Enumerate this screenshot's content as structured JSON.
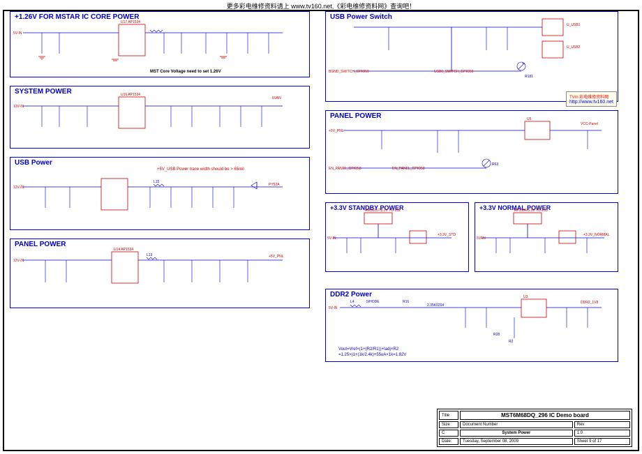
{
  "header": "更多彩电维修资料请上 www.tv160.net,《彩电维修资料网》查询吧！",
  "blocks": {
    "b1": {
      "title": "+1.26V FOR MSTAR IC CORE POWER",
      "note": "MST Core Voltage need to set 1.26V"
    },
    "b2": {
      "title": "SYSTEM POWER"
    },
    "b3": {
      "title": "USB Power",
      "note": "+5V_USB Power trace width should be > 65mil"
    },
    "b4": {
      "title": "PANEL POWER"
    },
    "b5": {
      "title": "USB Power Switch"
    },
    "b6": {
      "title": "PANEL POWER"
    },
    "b7": {
      "title": "+3.3V STANDBY POWER"
    },
    "b8": {
      "title": "+3.3V NORMAL POWER"
    },
    "b9": {
      "title": "DDR2 Power",
      "formula1": "Vout=Vref×(1+(R2/R1))+Iadj×R2",
      "formula2": "=1.25×(1+(1k/2.4k)+55uA×1k=1.82V"
    }
  },
  "watermark": {
    "top": "TVm 彩电维修资料网",
    "url": "http://www.tv160.net"
  },
  "titleblock": {
    "title_label": "Title",
    "title": "MST6M68DQ_296 IC Demo board",
    "docnum_label": "Document Number",
    "docnum": "System Power",
    "rev_label": "Rev",
    "rev": "1.0",
    "size_label": "Size",
    "size": "C",
    "date_label": "Date:",
    "date": "Tuesday, September 08, 2009",
    "sheet": "Sheet 9 of 17"
  },
  "components": {
    "regulator_33s": "AMS1117/3.3V TO-252",
    "regulator_33n": "AP1084/3.3V TO-263",
    "ic_ap1534": "AP1534",
    "inductor_shode": "5/HODE",
    "res_235k": "2.35K0204",
    "vin_5v": "5V-IN",
    "vin_12v": "12V-IN",
    "vout_33": "+3.3V_NORMAL",
    "vout_33s": "+3.3V_STD",
    "vout_ddr2": "DDR2_1V8",
    "vout_panel": "VCC-Panel",
    "vout_5van": "5VAN",
    "panel_net": "EN_PANEL_GPIO58",
    "usb_net": "BGND_SWITCH_GPIO59",
    "usb_net2": "USB0_SWITCH_GPIO59",
    "usb_conn": "U_USB1",
    "usb_conn2": "U_USB2"
  }
}
